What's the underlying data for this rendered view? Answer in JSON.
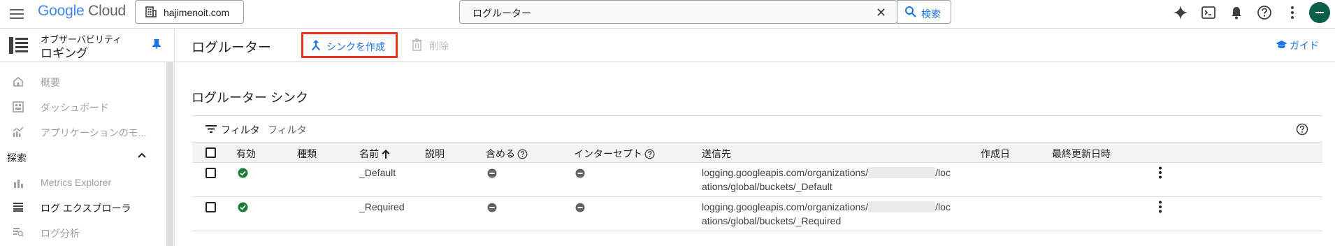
{
  "topbar": {
    "logo_google": "Google",
    "logo_cloud": "Cloud",
    "project": "hajimenoit.com",
    "search_value": "ログルーター",
    "search_button": "検索",
    "icons": [
      "menu-icon",
      "gemini-sparkle-icon",
      "cloud-shell-icon",
      "bell-icon",
      "help-icon",
      "more-vert-icon"
    ]
  },
  "sidebar": {
    "product_sup": "オブザーバビリティ",
    "product_title": "ロギング",
    "items": [
      {
        "label": "概要",
        "icon": "home-icon"
      },
      {
        "label": "ダッシュボード",
        "icon": "dashboard-icon"
      },
      {
        "label": "アプリケーションのモ...",
        "icon": "monitoring-chart-icon"
      }
    ],
    "section_label": "探索",
    "section_items": [
      {
        "label": "Metrics Explorer",
        "icon": "bar-chart-icon"
      },
      {
        "label": "ログ エクスプローラ",
        "icon": "list-icon"
      },
      {
        "label": "ログ分析",
        "icon": "log-analytics-icon"
      }
    ]
  },
  "actionbar": {
    "title": "ログルーター",
    "create_sink": "シンクを作成",
    "delete": "削除",
    "guide": "ガイド"
  },
  "table_section": {
    "title": "ログルーター シンク",
    "filter_label": "フィルタ",
    "filter_placeholder": "フィルタ",
    "headers": {
      "enabled": "有効",
      "type": "種類",
      "name": "名前",
      "description": "説明",
      "inclusion": "含める",
      "intercept": "インターセプト",
      "destination": "送信先",
      "created": "作成日",
      "updated": "最終更新日時"
    },
    "rows": [
      {
        "name": "_Default",
        "enabled": true,
        "dest_line1_prefix": "logging.googleapis.com/organizations/",
        "dest_line1_suffix": "/loc",
        "dest_line2": "ations/global/buckets/_Default"
      },
      {
        "name": "_Required",
        "enabled": true,
        "dest_line1_prefix": "logging.googleapis.com/organizations/",
        "dest_line1_suffix": "/loc",
        "dest_line2": "ations/global/buckets/_Required"
      }
    ]
  }
}
